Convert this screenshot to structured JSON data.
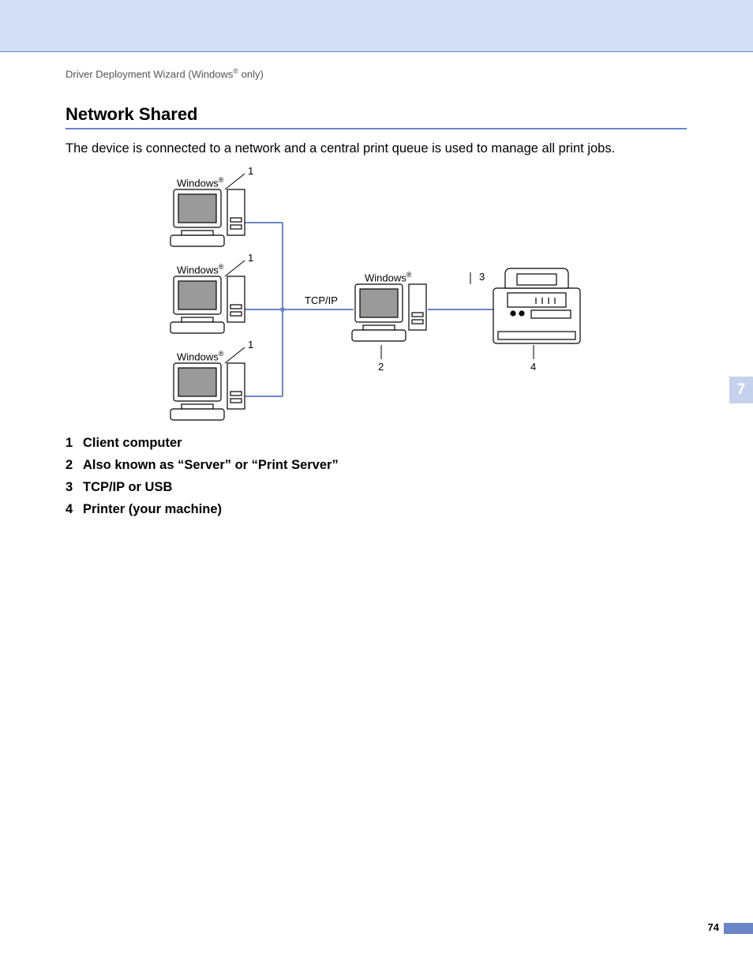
{
  "header": {
    "breadcrumb_prefix": "Driver Deployment Wizard (Windows",
    "breadcrumb_sup": "®",
    "breadcrumb_suffix": " only)"
  },
  "section": {
    "title": "Network Shared",
    "body": "The device is connected to a network and a central print queue is used to manage all print jobs."
  },
  "diagram": {
    "client_label_prefix": "Windows",
    "client_label_sup": "®",
    "server_label_prefix": "Windows",
    "server_label_sup": "®",
    "protocol": "TCP/IP",
    "callout1": "1",
    "callout2": "2",
    "callout3": "3",
    "callout4": "4"
  },
  "legend": {
    "items": [
      {
        "n": "1",
        "text": "Client computer"
      },
      {
        "n": "2",
        "text": "Also known as “Server” or “Print Server”"
      },
      {
        "n": "3",
        "text": "TCP/IP or USB"
      },
      {
        "n": "4",
        "text": "Printer (your machine)"
      }
    ]
  },
  "chapter_tab": "7",
  "page_number": "74"
}
